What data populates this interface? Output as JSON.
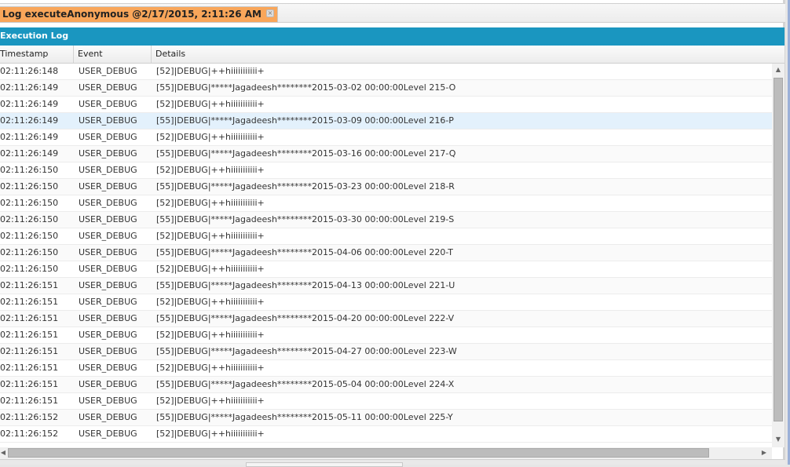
{
  "tab": {
    "label": "Log executeAnonymous @2/17/2015, 2:11:26 AM",
    "close": "×"
  },
  "panel_title": "Execution Log",
  "columns": [
    "Timestamp",
    "Event",
    "Details"
  ],
  "rows": [
    [
      "02:11:26:148",
      "USER_DEBUG",
      "[52]|DEBUG|++hiiiiiiiiiii+"
    ],
    [
      "02:11:26:149",
      "USER_DEBUG",
      "[55]|DEBUG|*****Jagadeesh********2015-03-02 00:00:00Level 215-O"
    ],
    [
      "02:11:26:149",
      "USER_DEBUG",
      "[52]|DEBUG|++hiiiiiiiiiii+"
    ],
    [
      "02:11:26:149",
      "USER_DEBUG",
      "[55]|DEBUG|*****Jagadeesh********2015-03-09 00:00:00Level 216-P"
    ],
    [
      "02:11:26:149",
      "USER_DEBUG",
      "[52]|DEBUG|++hiiiiiiiiiii+"
    ],
    [
      "02:11:26:149",
      "USER_DEBUG",
      "[55]|DEBUG|*****Jagadeesh********2015-03-16 00:00:00Level 217-Q"
    ],
    [
      "02:11:26:150",
      "USER_DEBUG",
      "[52]|DEBUG|++hiiiiiiiiiii+"
    ],
    [
      "02:11:26:150",
      "USER_DEBUG",
      "[55]|DEBUG|*****Jagadeesh********2015-03-23 00:00:00Level 218-R"
    ],
    [
      "02:11:26:150",
      "USER_DEBUG",
      "[52]|DEBUG|++hiiiiiiiiiii+"
    ],
    [
      "02:11:26:150",
      "USER_DEBUG",
      "[55]|DEBUG|*****Jagadeesh********2015-03-30 00:00:00Level 219-S"
    ],
    [
      "02:11:26:150",
      "USER_DEBUG",
      "[52]|DEBUG|++hiiiiiiiiiii+"
    ],
    [
      "02:11:26:150",
      "USER_DEBUG",
      "[55]|DEBUG|*****Jagadeesh********2015-04-06 00:00:00Level 220-T"
    ],
    [
      "02:11:26:150",
      "USER_DEBUG",
      "[52]|DEBUG|++hiiiiiiiiiii+"
    ],
    [
      "02:11:26:151",
      "USER_DEBUG",
      "[55]|DEBUG|*****Jagadeesh********2015-04-13 00:00:00Level 221-U"
    ],
    [
      "02:11:26:151",
      "USER_DEBUG",
      "[52]|DEBUG|++hiiiiiiiiiii+"
    ],
    [
      "02:11:26:151",
      "USER_DEBUG",
      "[55]|DEBUG|*****Jagadeesh********2015-04-20 00:00:00Level 222-V"
    ],
    [
      "02:11:26:151",
      "USER_DEBUG",
      "[52]|DEBUG|++hiiiiiiiiiii+"
    ],
    [
      "02:11:26:151",
      "USER_DEBUG",
      "[55]|DEBUG|*****Jagadeesh********2015-04-27 00:00:00Level 223-W"
    ],
    [
      "02:11:26:151",
      "USER_DEBUG",
      "[52]|DEBUG|++hiiiiiiiiiii+"
    ],
    [
      "02:11:26:151",
      "USER_DEBUG",
      "[55]|DEBUG|*****Jagadeesh********2015-05-04 00:00:00Level 224-X"
    ],
    [
      "02:11:26:151",
      "USER_DEBUG",
      "[52]|DEBUG|++hiiiiiiiiiii+"
    ],
    [
      "02:11:26:152",
      "USER_DEBUG",
      "[55]|DEBUG|*****Jagadeesh********2015-05-11 00:00:00Level 225-Y"
    ],
    [
      "02:11:26:152",
      "USER_DEBUG",
      "[52]|DEBUG|++hiiiiiiiiiii+"
    ]
  ],
  "selected_row": 3,
  "colors": {
    "tab": "#f9a65a",
    "header": "#1a96c0",
    "selected": "#e3f1fc"
  }
}
